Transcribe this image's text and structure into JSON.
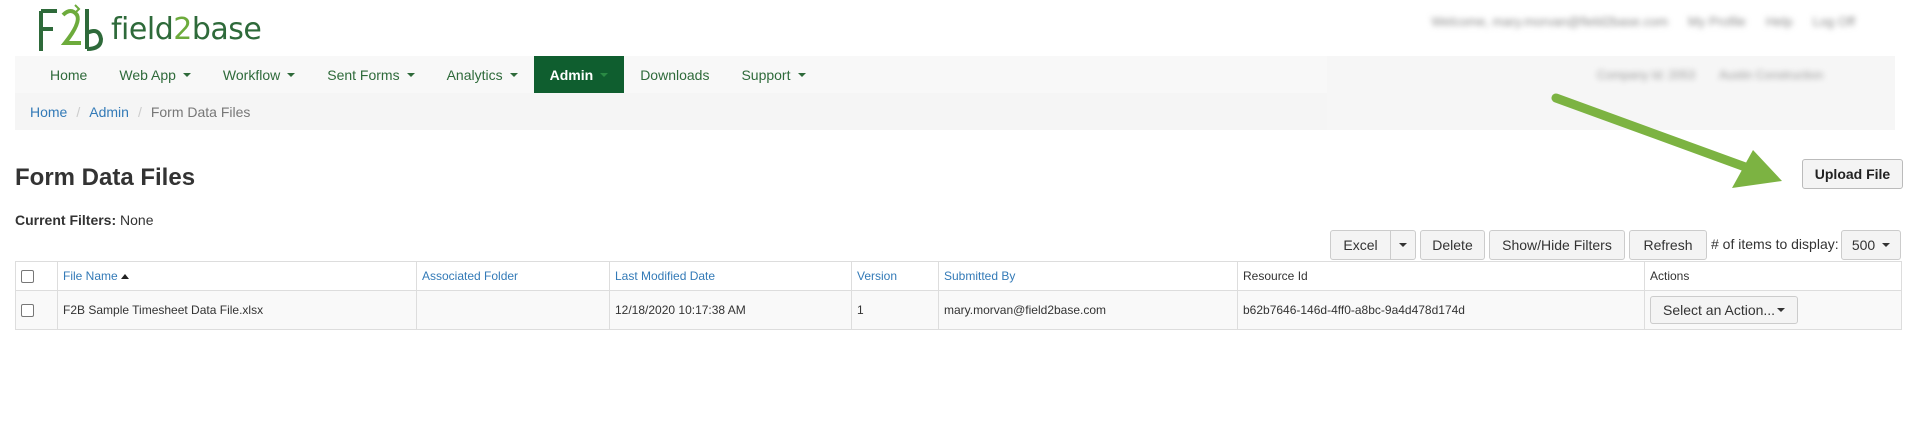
{
  "brand": {
    "name_part1": "field",
    "name_part2": "2",
    "name_part3": "base",
    "primary_color": "#0f5e2f",
    "accent_color": "#6dab3c"
  },
  "user_links": [
    "Welcome, mary.morvan@field2base.com",
    "My Profile",
    "Help",
    "Log Off"
  ],
  "nav": {
    "items": [
      {
        "label": "Home",
        "dropdown": false
      },
      {
        "label": "Web App",
        "dropdown": true
      },
      {
        "label": "Workflow",
        "dropdown": true
      },
      {
        "label": "Sent Forms",
        "dropdown": true
      },
      {
        "label": "Analytics",
        "dropdown": true
      },
      {
        "label": "Admin",
        "dropdown": true,
        "active": true
      },
      {
        "label": "Downloads",
        "dropdown": false
      },
      {
        "label": "Support",
        "dropdown": true
      }
    ]
  },
  "company_panel": {
    "company_label": "Company Id: 2053",
    "selector": "Austin Construction"
  },
  "breadcrumb": {
    "home": "Home",
    "admin": "Admin",
    "current": "Form Data Files"
  },
  "page": {
    "title": "Form Data Files",
    "filters_label": "Current Filters:",
    "filters_value": "None",
    "upload_label": "Upload File"
  },
  "toolbar": {
    "excel": "Excel",
    "delete": "Delete",
    "show_hide": "Show/Hide Filters",
    "refresh": "Refresh",
    "items_label": "# of items to display:",
    "items_value": "500"
  },
  "table": {
    "headers": {
      "file_name": "File Name",
      "folder": "Associated Folder",
      "modified": "Last Modified Date",
      "version": "Version",
      "submitted_by": "Submitted By",
      "resource_id": "Resource Id",
      "actions": "Actions"
    },
    "rows": [
      {
        "file_name": "F2B Sample Timesheet Data File.xlsx",
        "folder": "",
        "modified": "12/18/2020 10:17:38 AM",
        "version": "1",
        "submitted_by": "mary.morvan@field2base.com",
        "resource_id": "b62b7646-146d-4ff0-a8bc-9a4d478d174d",
        "action_label": "Select an Action..."
      }
    ]
  }
}
